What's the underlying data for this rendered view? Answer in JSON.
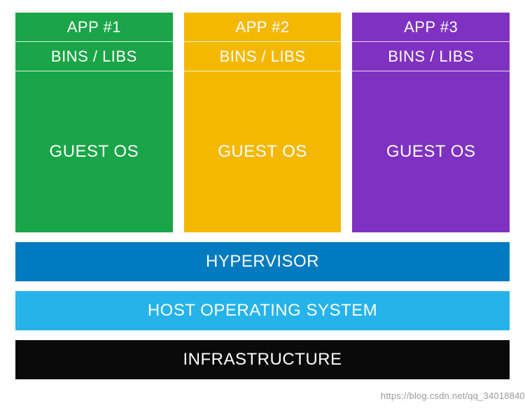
{
  "diagram": {
    "vms": [
      {
        "app": "APP #1",
        "bins": "BINS / LIBS",
        "guest": "GUEST OS",
        "color": "#1aa548"
      },
      {
        "app": "APP #2",
        "bins": "BINS / LIBS",
        "guest": "GUEST OS",
        "color": "#f5b800"
      },
      {
        "app": "APP #3",
        "bins": "BINS / LIBS",
        "guest": "GUEST OS",
        "color": "#7f31c2"
      }
    ],
    "hypervisor": "HYPERVISOR",
    "host_os": "HOST OPERATING SYSTEM",
    "infrastructure": "INFRASTRUCTURE",
    "colors": {
      "hypervisor": "#007bc0",
      "host_os": "#25b3ea",
      "infrastructure": "#0a0a0a"
    }
  },
  "watermark": "https://blog.csdn.net/qq_34018840"
}
